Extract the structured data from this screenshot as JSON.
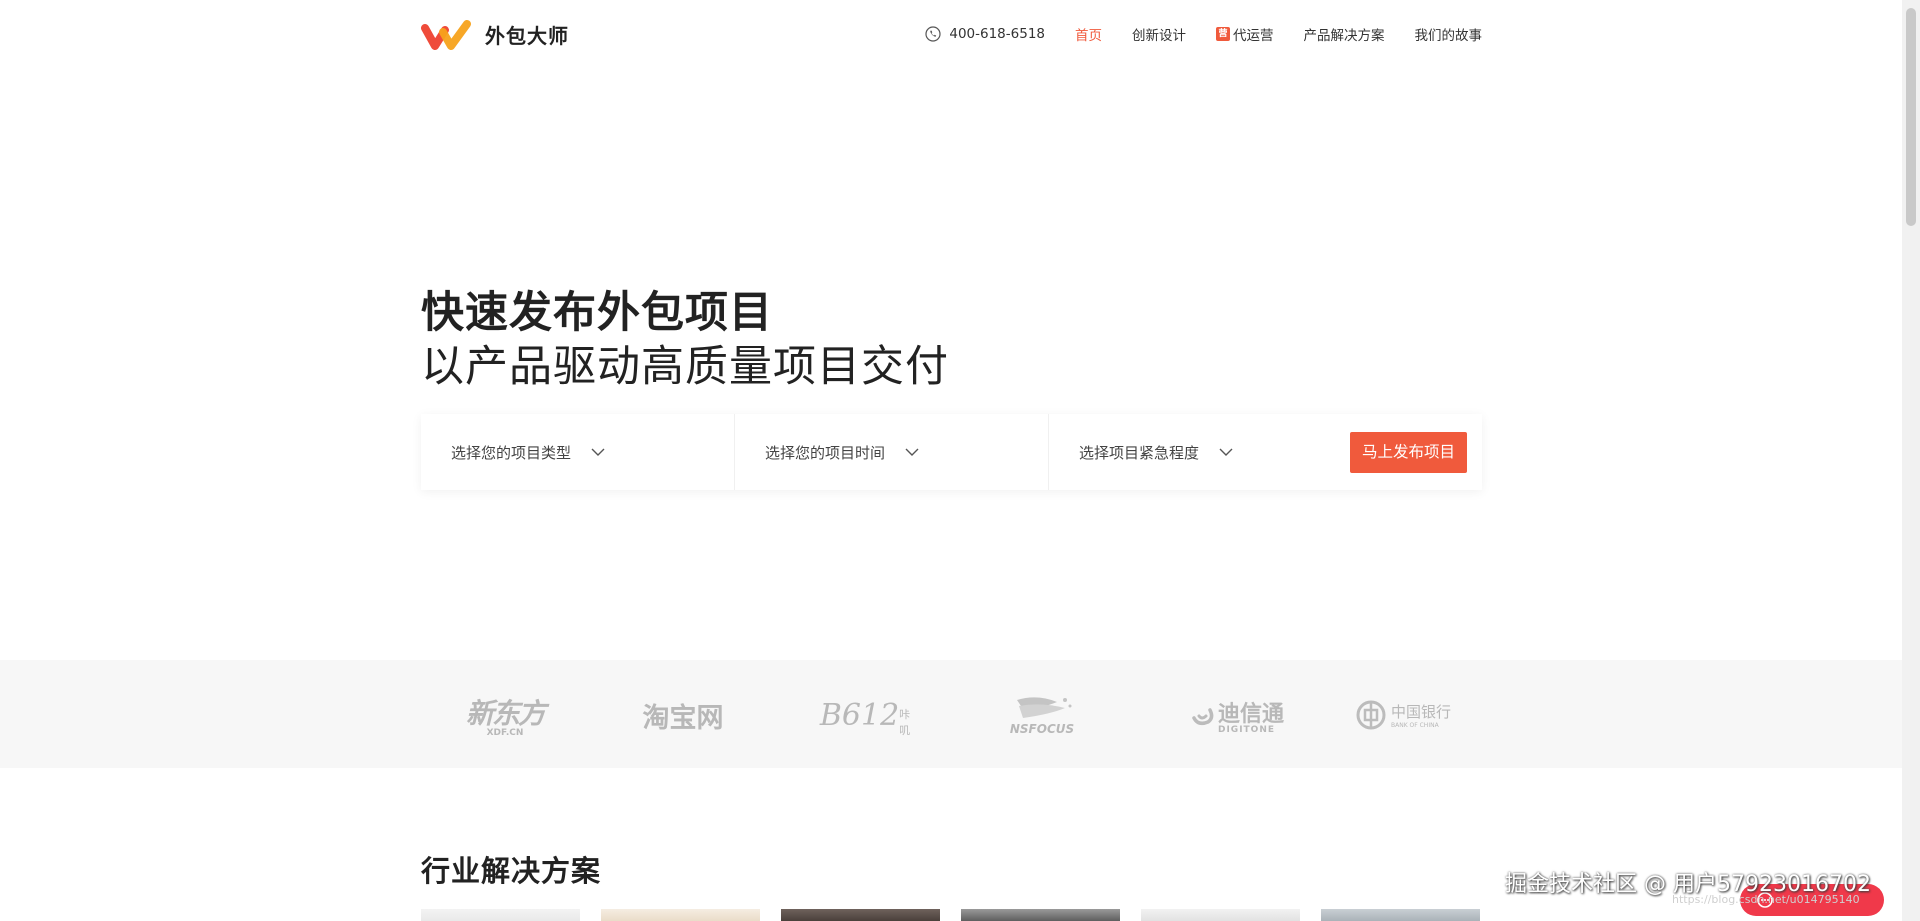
{
  "brand": {
    "name": "外包大师"
  },
  "nav": {
    "phone": "400-618-6518",
    "items": [
      {
        "label": "首页",
        "active": true
      },
      {
        "label": "创新设计"
      },
      {
        "label": "代运营",
        "badge": "营"
      },
      {
        "label": "产品解决方案"
      },
      {
        "label": "我们的故事"
      }
    ]
  },
  "hero": {
    "title_line1": "快速发布外包项目",
    "title_line2": "以产品驱动高质量项目交付"
  },
  "search": {
    "project_type": "选择您的项目类型",
    "project_time": "选择您的项目时间",
    "project_urgency": "选择项目紧急程度",
    "publish_label": "马上发布项目"
  },
  "clients": {
    "xdf": {
      "main": "新东方",
      "sub": "XDF.CN"
    },
    "taobao": {
      "main": "淘宝网"
    },
    "b612": {
      "main": "B612",
      "sub": "咔叽"
    },
    "nsfocus": {
      "main": "NSFOCUS"
    },
    "digitone": {
      "main": "迪信通",
      "sub": "DIGITONE"
    },
    "boc": {
      "main": "中国银行",
      "sub": "BANK OF CHINA"
    }
  },
  "sections": {
    "industry_title": "行业解决方案"
  },
  "watermark": {
    "text": "掘金技术社区 @ 用户5792301670​2",
    "url": "https://blog.csdn.net/u014795140"
  },
  "colors": {
    "accent": "#f05a3c",
    "logo_orange": "#f7a21b",
    "logo_red": "#ef4b3a"
  }
}
